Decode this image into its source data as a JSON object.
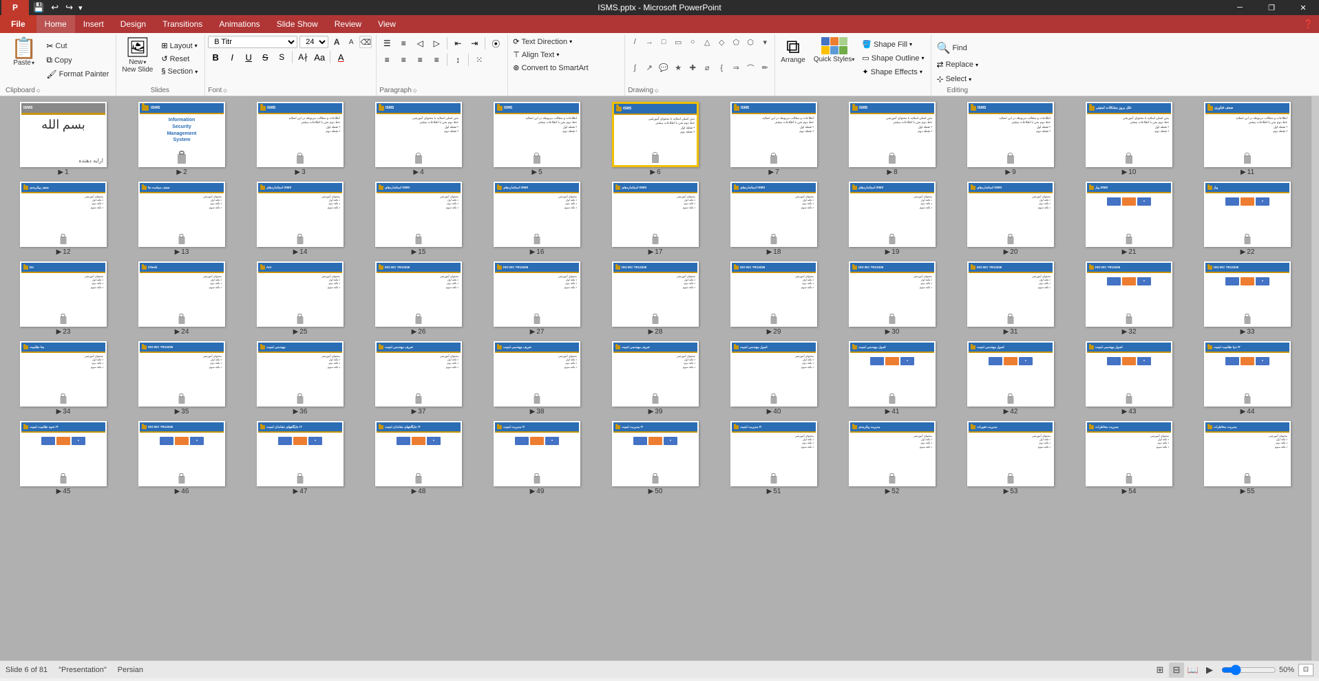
{
  "window": {
    "title": "ISMS.pptx - Microsoft PowerPoint",
    "controls": {
      "minimize": "─",
      "restore": "❐",
      "close": "✕"
    }
  },
  "quick_access": {
    "buttons": [
      "💾",
      "↩",
      "↪",
      "▸"
    ]
  },
  "menu": {
    "file_label": "File",
    "items": [
      "Home",
      "Insert",
      "Design",
      "Transitions",
      "Animations",
      "Slide Show",
      "Review",
      "View"
    ]
  },
  "ribbon": {
    "groups": {
      "clipboard": {
        "label": "Clipboard",
        "paste": "Paste",
        "cut": "Cut",
        "copy": "Copy",
        "format_painter": "Format Painter"
      },
      "slides": {
        "label": "Slides",
        "new_slide": "New Slide",
        "layout": "Layout",
        "reset": "Reset",
        "section": "Section"
      },
      "font": {
        "label": "Font",
        "font_name": "B Titr",
        "font_size": "24",
        "bold": "B",
        "italic": "I",
        "underline": "U",
        "strikethrough": "S",
        "shadow": "S",
        "font_color": "A"
      },
      "paragraph": {
        "label": "Paragraph",
        "align_left": "≡",
        "align_center": "≡",
        "align_right": "≡",
        "justify": "≡",
        "bullet_list": "☰",
        "numbered_list": "☰",
        "indent_less": "◁",
        "indent_more": "▷",
        "line_spacing": "↕",
        "columns": "⦿"
      },
      "drawing": {
        "label": "Drawing",
        "text_direction": "Text Direction",
        "align_text": "Align Text",
        "convert_smartart": "Convert to SmartArt"
      },
      "arrange": {
        "label": "",
        "arrange_btn": "Arrange",
        "quick_styles": "Quick Styles",
        "shape_fill": "Shape Fill",
        "shape_outline": "Shape Outline",
        "shape_effects": "Shape Effects"
      },
      "editing": {
        "label": "Editing",
        "find": "Find",
        "replace": "Replace",
        "select": "Select"
      }
    }
  },
  "slides": {
    "total": 81,
    "current": 6,
    "items": [
      {
        "num": 1,
        "title": "",
        "has_lock": false,
        "selected": false,
        "type": "calligraphy"
      },
      {
        "num": 2,
        "title": "ISMS",
        "subtitle": "Information Security Management System",
        "has_lock": true,
        "selected": false,
        "type": "isms_cover"
      },
      {
        "num": 3,
        "title": "ISMS",
        "has_lock": true,
        "selected": false,
        "type": "text_slide"
      },
      {
        "num": 4,
        "title": "ISMS",
        "has_lock": true,
        "selected": false,
        "type": "text_slide"
      },
      {
        "num": 5,
        "title": "ISMS",
        "has_lock": true,
        "selected": false,
        "type": "text_slide"
      },
      {
        "num": 6,
        "title": "ISMS",
        "has_lock": true,
        "selected": true,
        "type": "text_slide"
      },
      {
        "num": 7,
        "title": "ISMS",
        "has_lock": true,
        "selected": false,
        "type": "text_slide"
      },
      {
        "num": 8,
        "title": "ISMS",
        "has_lock": true,
        "selected": false,
        "type": "text_slide"
      },
      {
        "num": 9,
        "title": "ISMS",
        "has_lock": true,
        "selected": false,
        "type": "text_slide"
      },
      {
        "num": 10,
        "title": "علل بروز مشکلات امنیتی",
        "has_lock": true,
        "selected": false,
        "type": "rtl_slide"
      },
      {
        "num": 11,
        "title": "ضعف فناوری",
        "has_lock": true,
        "selected": false,
        "type": "rtl_slide"
      },
      {
        "num": 12,
        "title": "ضعف پیکربندی",
        "has_lock": true,
        "selected": false,
        "type": "rtl_slide"
      },
      {
        "num": 13,
        "title": "ضعف سیاست ها",
        "has_lock": true,
        "selected": false,
        "type": "rtl_slide"
      },
      {
        "num": 14,
        "title": "استانداردهای ISMS",
        "has_lock": true,
        "selected": false,
        "type": "text_slide"
      },
      {
        "num": 15,
        "title": "استانداردهای ISMS",
        "has_lock": true,
        "selected": false,
        "type": "text_slide"
      },
      {
        "num": 16,
        "title": "استانداردهای ISMS",
        "has_lock": true,
        "selected": false,
        "type": "text_slide"
      },
      {
        "num": 17,
        "title": "استانداردهای ISMS",
        "has_lock": true,
        "selected": false,
        "type": "text_slide"
      },
      {
        "num": 18,
        "title": "استانداردهای ISMS",
        "has_lock": true,
        "selected": false,
        "type": "text_slide"
      },
      {
        "num": 19,
        "title": "استانداردهای ISMS",
        "has_lock": true,
        "selected": false,
        "type": "text_slide"
      },
      {
        "num": 20,
        "title": "استانداردهای ISMS",
        "has_lock": true,
        "selected": false,
        "type": "text_slide"
      },
      {
        "num": 21,
        "title": "پیاز ISMS",
        "has_lock": true,
        "selected": false,
        "type": "diagram_slide"
      },
      {
        "num": 22,
        "title": "پیاز",
        "has_lock": true,
        "selected": false,
        "type": "diagram_slide"
      },
      {
        "num": 23,
        "title": "Do",
        "has_lock": true,
        "selected": false,
        "type": "text_slide"
      },
      {
        "num": 24,
        "title": "Check",
        "has_lock": true,
        "selected": false,
        "type": "text_slide"
      },
      {
        "num": 25,
        "title": "Act",
        "has_lock": true,
        "selected": false,
        "type": "text_slide"
      },
      {
        "num": 26,
        "title": "ISO IEC TR13335",
        "has_lock": true,
        "selected": false,
        "type": "text_slide"
      },
      {
        "num": 27,
        "title": "ISO IEC TR13335",
        "has_lock": true,
        "selected": false,
        "type": "text_slide"
      },
      {
        "num": 28,
        "title": "ISO IEC TR13335",
        "has_lock": true,
        "selected": false,
        "type": "text_slide"
      },
      {
        "num": 29,
        "title": "ISO IEC TR13335",
        "has_lock": true,
        "selected": false,
        "type": "text_slide"
      },
      {
        "num": 30,
        "title": "ISO IEC TR13335",
        "has_lock": true,
        "selected": false,
        "type": "text_slide"
      },
      {
        "num": 31,
        "title": "ISO IEC TR13335",
        "has_lock": true,
        "selected": false,
        "type": "text_slide"
      },
      {
        "num": 32,
        "title": "ISO IEC TR13335",
        "has_lock": true,
        "selected": false,
        "type": "diagram_slide"
      },
      {
        "num": 33,
        "title": "ISO IEC TR13335",
        "has_lock": true,
        "selected": false,
        "type": "diagram_slide"
      },
      {
        "num": 34,
        "title": "بحا نظامیت",
        "has_lock": true,
        "selected": false,
        "type": "text_slide"
      },
      {
        "num": 35,
        "title": "ISO IEC TR13335",
        "has_lock": true,
        "selected": false,
        "type": "text_slide"
      },
      {
        "num": 36,
        "title": "مهندسی امنیت",
        "has_lock": true,
        "selected": false,
        "type": "text_slide"
      },
      {
        "num": 37,
        "title": "تعریف مهندسی امنیت",
        "has_lock": true,
        "selected": false,
        "type": "text_slide"
      },
      {
        "num": 38,
        "title": "تعریف مهندسی امنیت",
        "has_lock": true,
        "selected": false,
        "type": "text_slide"
      },
      {
        "num": 39,
        "title": "تعریف مهندسی امنیت",
        "has_lock": true,
        "selected": false,
        "type": "text_slide"
      },
      {
        "num": 40,
        "title": "اصول مهندسی امنیت",
        "has_lock": true,
        "selected": false,
        "type": "text_slide"
      },
      {
        "num": 41,
        "title": "اصول مهندسی امنیت",
        "has_lock": true,
        "selected": false,
        "type": "diagram_slide"
      },
      {
        "num": 42,
        "title": "اصول مهندسی امنیت",
        "has_lock": true,
        "selected": false,
        "type": "diagram_slide"
      },
      {
        "num": 43,
        "title": "اصول مهندسی امنیت",
        "has_lock": true,
        "selected": false,
        "type": "diagram_slide"
      },
      {
        "num": 44,
        "title": "دنیا نظامیت امنیت IT",
        "has_lock": true,
        "selected": false,
        "type": "diagram_slide"
      },
      {
        "num": 45,
        "title": "نحوه نظامیت امنیت IT",
        "has_lock": true,
        "selected": false,
        "type": "diagram_slide"
      },
      {
        "num": 46,
        "title": "ISO IEC TR13335",
        "has_lock": true,
        "selected": false,
        "type": "diagram_slide"
      },
      {
        "num": 47,
        "title": "جایگاههای نشاندان امنیت IT",
        "has_lock": true,
        "selected": false,
        "type": "diagram_slide"
      },
      {
        "num": 48,
        "title": "جایگاههای نشاندان امنیت IT",
        "has_lock": true,
        "selected": false,
        "type": "diagram_slide"
      },
      {
        "num": 49,
        "title": "مدیریت امنیت IT",
        "has_lock": true,
        "selected": false,
        "type": "diagram_slide"
      },
      {
        "num": 50,
        "title": "مدیریت امنیت IT",
        "has_lock": true,
        "selected": false,
        "type": "diagram_slide"
      },
      {
        "num": 51,
        "title": "مدیریت امنیت IT",
        "has_lock": true,
        "selected": false,
        "type": "text_slide"
      },
      {
        "num": 52,
        "title": "مدیریت پیکربندی",
        "has_lock": true,
        "selected": false,
        "type": "text_slide"
      },
      {
        "num": 53,
        "title": "مدیریت تغییرات",
        "has_lock": true,
        "selected": false,
        "type": "text_slide"
      },
      {
        "num": 54,
        "title": "مدیریت مخاطرات",
        "has_lock": true,
        "selected": false,
        "type": "text_slide"
      },
      {
        "num": 55,
        "title": "مدیریت مخاطرات",
        "has_lock": true,
        "selected": false,
        "type": "text_slide"
      }
    ]
  },
  "status": {
    "slide_info": "Slide 6 of 81",
    "presentation_label": "\"Presentation\"",
    "language": "Persian",
    "zoom": "50%",
    "view_icons": [
      "normal",
      "slide_sorter",
      "reading",
      "slideshow"
    ]
  },
  "colors": {
    "blue_header": "#2a6db5",
    "gold_bar": "#c8960c",
    "ribbon_accent": "#b03535",
    "selected_border": "#f0c000",
    "folder_icon": "#e6a817"
  }
}
